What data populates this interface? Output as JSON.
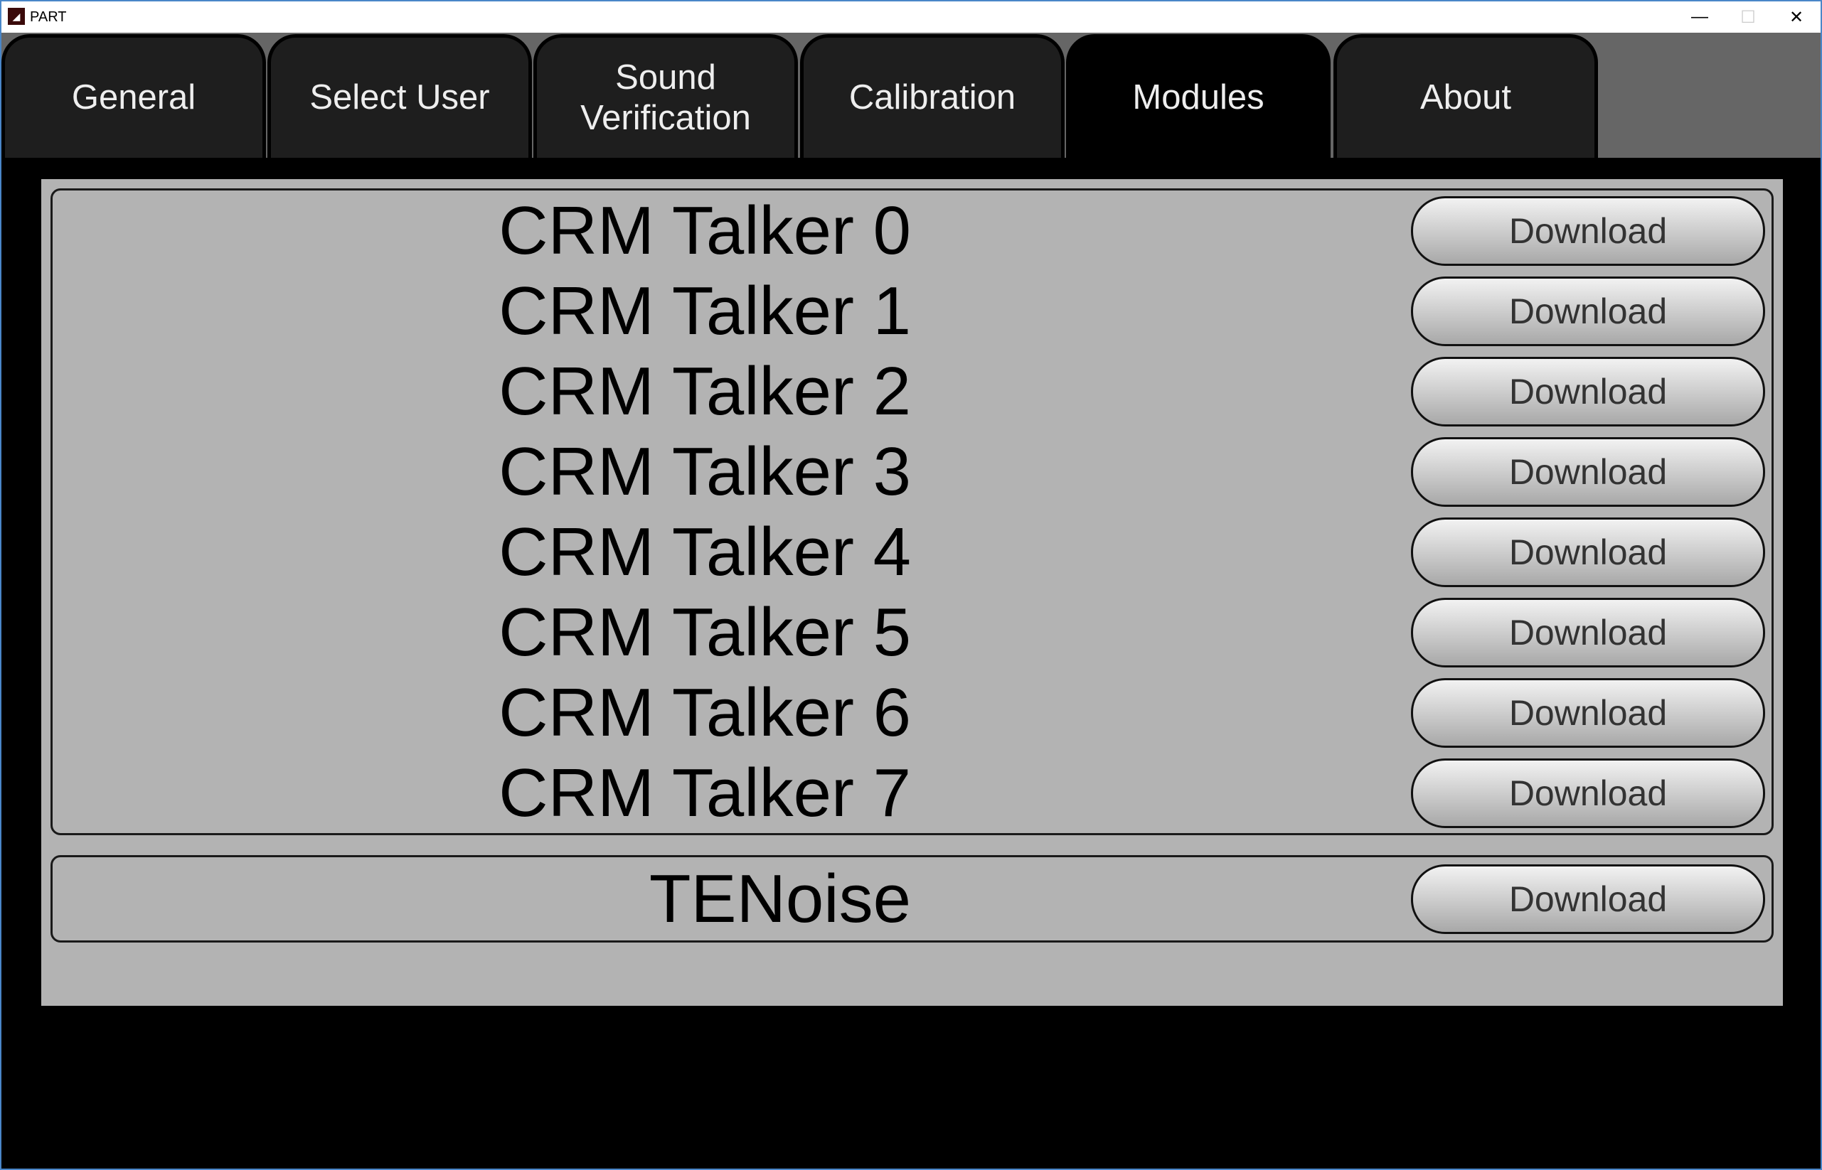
{
  "window": {
    "title": "PART",
    "icon_text": "PART"
  },
  "tabs": [
    {
      "label": "General"
    },
    {
      "label": "Select User"
    },
    {
      "label": "Sound Verification"
    },
    {
      "label": "Calibration"
    },
    {
      "label": "Modules",
      "active": true
    },
    {
      "label": "About"
    }
  ],
  "modules": {
    "crm_talkers": [
      {
        "name": "CRM Talker 0",
        "button": "Download"
      },
      {
        "name": "CRM Talker 1",
        "button": "Download"
      },
      {
        "name": "CRM Talker 2",
        "button": "Download"
      },
      {
        "name": "CRM Talker 3",
        "button": "Download"
      },
      {
        "name": "CRM Talker 4",
        "button": "Download"
      },
      {
        "name": "CRM Talker 5",
        "button": "Download"
      },
      {
        "name": "CRM Talker 6",
        "button": "Download"
      },
      {
        "name": "CRM Talker 7",
        "button": "Download"
      }
    ],
    "tenoise": {
      "name": "TENoise",
      "button": "Download"
    }
  }
}
